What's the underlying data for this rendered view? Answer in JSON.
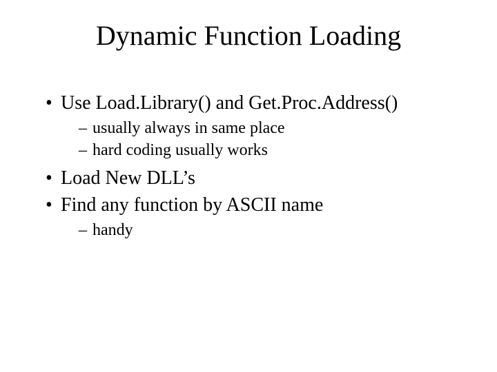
{
  "title": "Dynamic Function Loading",
  "bullets": {
    "b1": "Use Load.Library() and Get.Proc.Address()",
    "b1_sub1": "usually always in same place",
    "b1_sub2": "hard coding usually works",
    "b2": "Load New DLL’s",
    "b3": "Find any function by ASCII name",
    "b3_sub1": "handy"
  }
}
